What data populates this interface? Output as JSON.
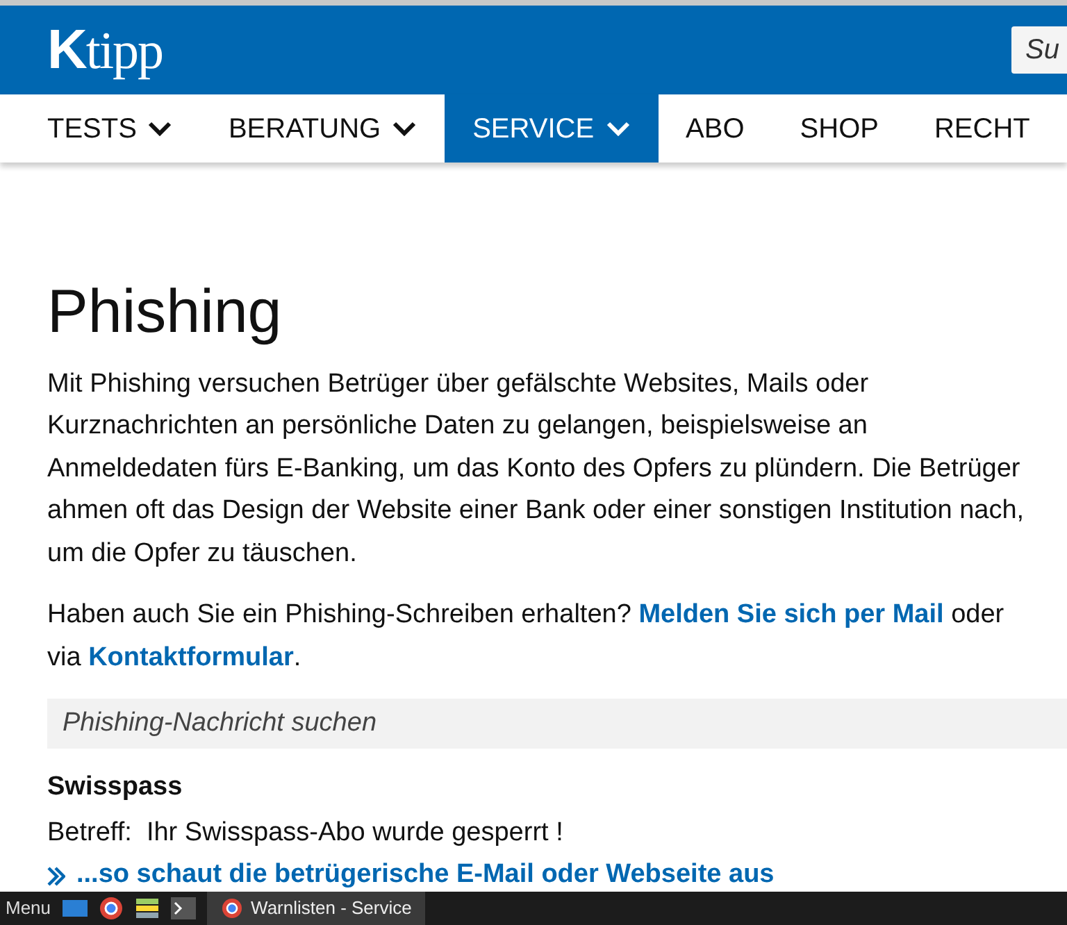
{
  "header": {
    "logo": {
      "initial": "K",
      "rest": "tipp"
    },
    "search": {
      "placeholder": "Su"
    }
  },
  "nav": [
    {
      "label": "TESTS",
      "dropdown": true,
      "selected": false
    },
    {
      "label": "BERATUNG",
      "dropdown": true,
      "selected": false
    },
    {
      "label": "SERVICE",
      "dropdown": true,
      "selected": true
    },
    {
      "label": "ABO",
      "dropdown": false,
      "selected": false
    },
    {
      "label": "SHOP",
      "dropdown": false,
      "selected": false
    },
    {
      "label": "RECHT",
      "dropdown": false,
      "selected": false
    }
  ],
  "article": {
    "title": "Phishing",
    "intro": "Mit Phishing versuchen Betrüger über gefälschte Websites, Mails oder Kurznachrichten an persönliche Daten zu gelangen, beispielsweise an Anmeldedaten fürs E-Banking, um das Konto des Opfers zu plündern. Die Betrüger ahmen oft das Design der Website einer Bank oder einer sonstigen Institution nach, um die Opfer zu täuschen.",
    "report": [
      {
        "kind": "text",
        "text": "Haben auch Sie ein Phishing-Schreiben erhalten? "
      },
      {
        "kind": "link",
        "text": "Melden Sie sich per Mail"
      },
      {
        "kind": "text",
        "text": " oder via "
      },
      {
        "kind": "link",
        "text": "Kontaktformular"
      },
      {
        "kind": "text",
        "text": "."
      }
    ],
    "search": {
      "placeholder": "Phishing-Nachricht suchen"
    },
    "entries": [
      {
        "title": "Swisspass",
        "subject": "Betreff:  Ihr Swisspass-Abo wurde gesperrt !",
        "link": "...so schaut die betrügerische E-Mail oder Webseite aus"
      }
    ]
  },
  "taskbar": {
    "menu": "Menu",
    "windows": [
      {
        "title": "Warnlisten - Service",
        "selected": true
      }
    ]
  }
}
